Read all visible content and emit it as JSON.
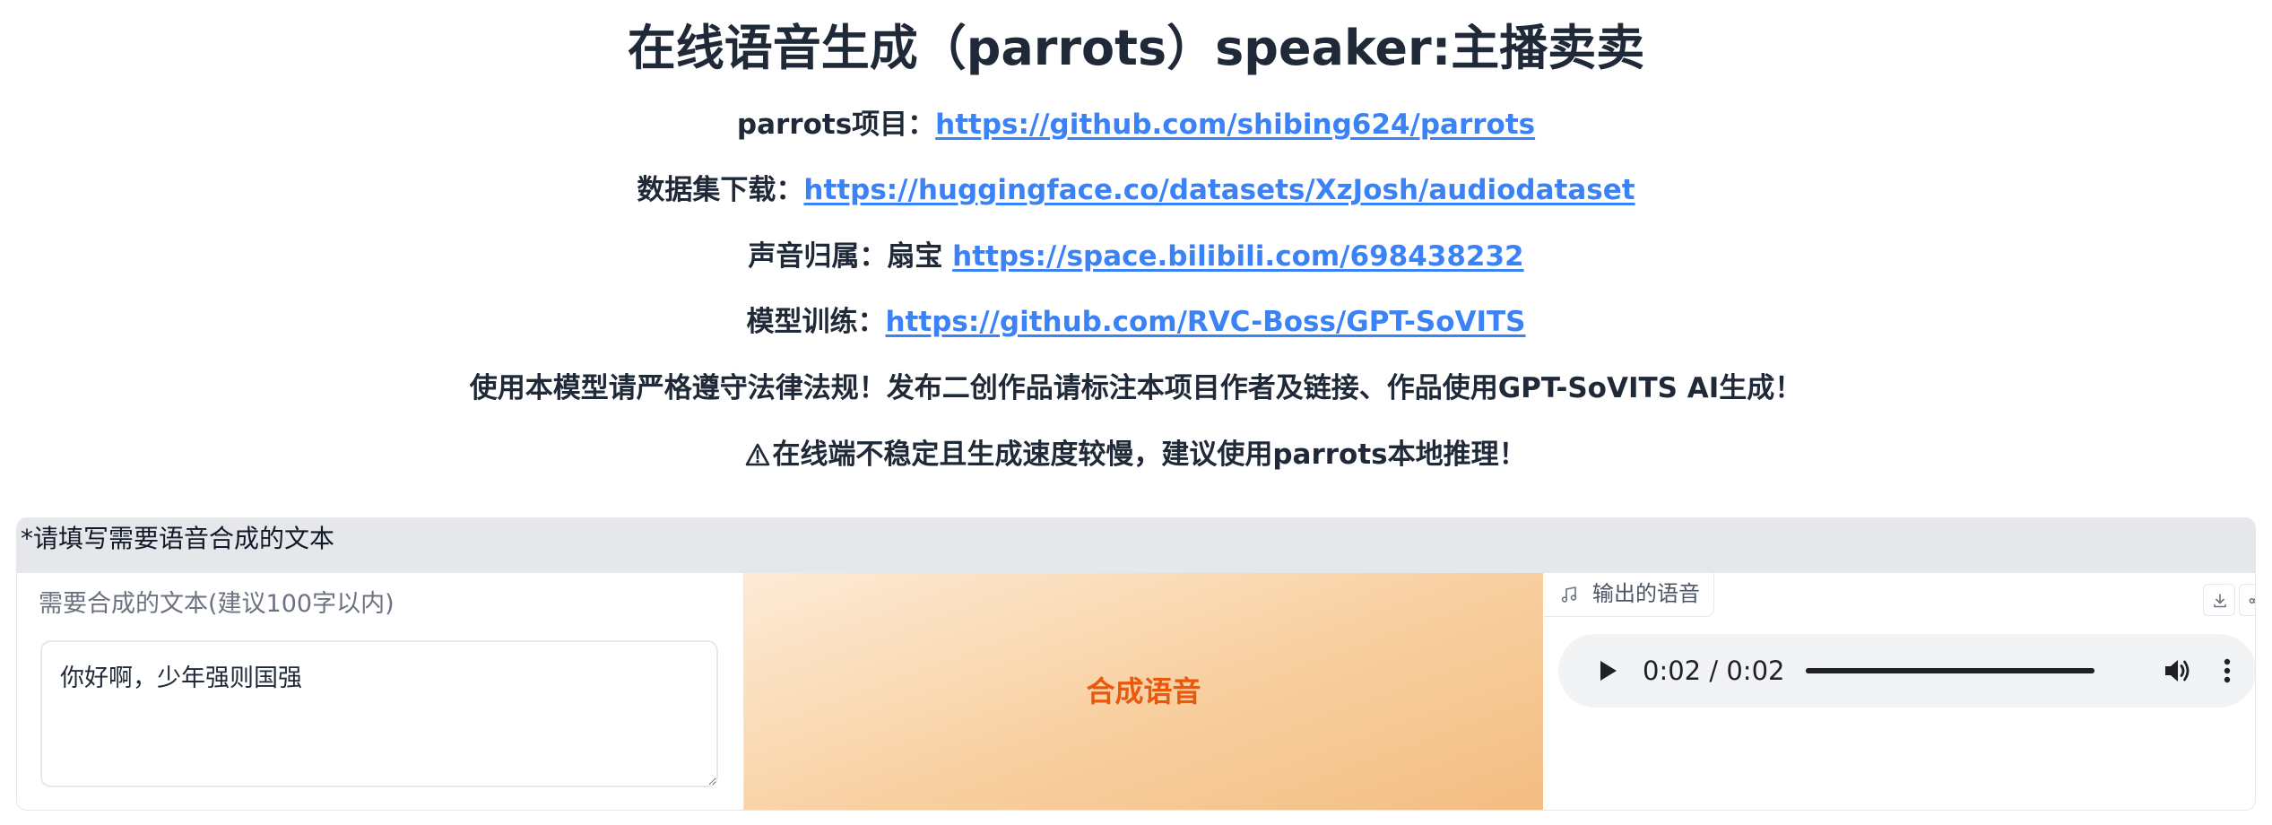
{
  "header": {
    "title": "在线语音生成（parrots）speaker:主播卖卖",
    "lines": [
      {
        "label": "parrots项目：",
        "link": "https://github.com/shibing624/parrots"
      },
      {
        "label": "数据集下载：",
        "link": "https://huggingface.co/datasets/XzJosh/audiodataset"
      },
      {
        "label": "声音归属：扇宝 ",
        "link": "https://space.bilibili.com/698438232"
      },
      {
        "label": "模型训练：",
        "link": "https://github.com/RVC-Boss/GPT-SoVITS"
      }
    ],
    "notice": "使用本模型请严格遵守法律法规！发布二创作品请标注本项目作者及链接、作品使用GPT-SoVITS AI生成！",
    "warning": "在线端不稳定且生成速度较慢，建议使用parrots本地推理！",
    "warning_icon": "warning-triangle-icon"
  },
  "block": {
    "header": "*请填写需要语音合成的文本",
    "input": {
      "label": "需要合成的文本(建议100字以内)",
      "value": "你好啊，少年强则国强"
    },
    "generate_button": "合成语音",
    "output": {
      "label": "输出的语音",
      "label_icon": "music-note-icon",
      "download_icon": "download-icon",
      "share_icon": "share-icon",
      "player": {
        "current_time": "0:02",
        "separator": "/",
        "duration": "0:02",
        "progress": 1.0,
        "play_icon": "play-icon",
        "volume_icon": "volume-icon",
        "more_icon": "more-vertical-icon"
      }
    }
  },
  "colors": {
    "link": "#3b82f6",
    "accent": "#ea580c",
    "header_bg": "#e5e7eb"
  }
}
